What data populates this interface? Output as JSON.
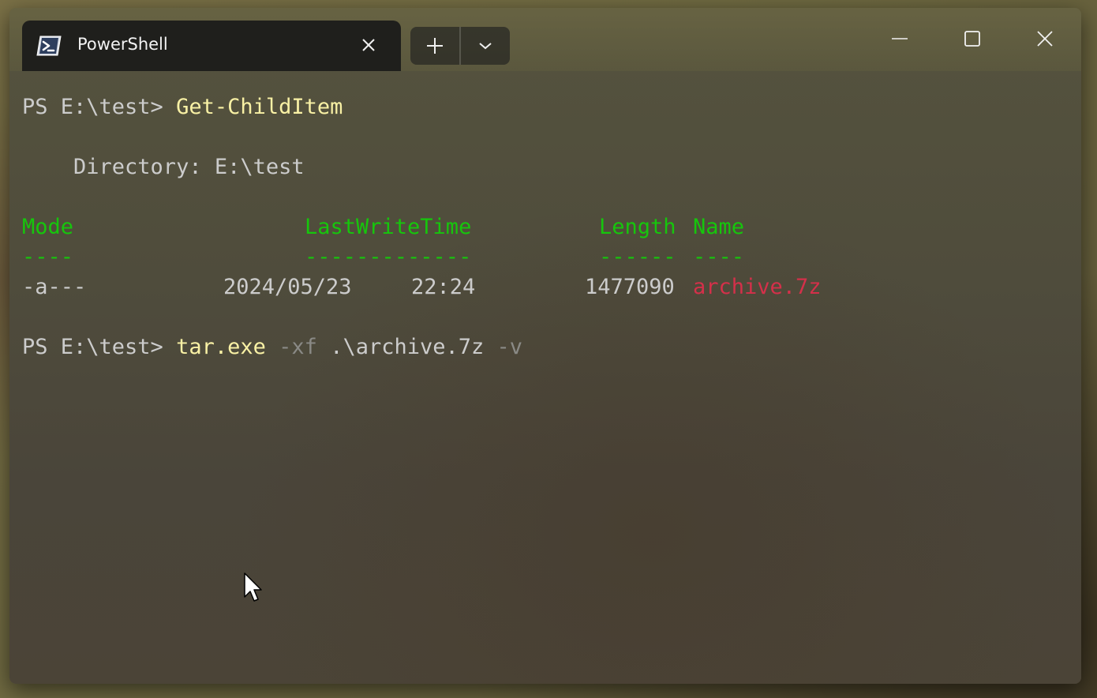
{
  "window": {
    "tab_title": "PowerShell",
    "tab_icon": "powershell-icon",
    "new_tab_icon": "plus-icon",
    "dropdown_icon": "chevron-down-icon",
    "caption_buttons": [
      "minimize-icon",
      "maximize-icon",
      "close-icon"
    ]
  },
  "terminal": {
    "line1": {
      "prompt": "PS E:\\test> ",
      "command": "Get-ChildItem"
    },
    "directory_line": "    Directory: E:\\test",
    "headers": {
      "mode": "Mode",
      "lastwritetime": "LastWriteTime",
      "length": "Length",
      "name": "Name"
    },
    "underlines": {
      "mode": "----",
      "lastwritetime": "-------------",
      "length": "------",
      "name": "----"
    },
    "rows": [
      {
        "mode": "-a---",
        "date": "2024/05/23",
        "time": "22:24",
        "length": "1477090",
        "name": "archive.7z"
      }
    ],
    "line2": {
      "prompt": "PS E:\\test> ",
      "command": "tar.exe",
      "flag1": "-xf",
      "arg": ".\\archive.7z",
      "flag2": "-v"
    }
  },
  "colors": {
    "header_green": "#16c60c",
    "command_yellow": "#f9f1a5",
    "param_gray": "#8a8a86",
    "archive_red": "#d4304a",
    "text_default": "#cccccc"
  }
}
